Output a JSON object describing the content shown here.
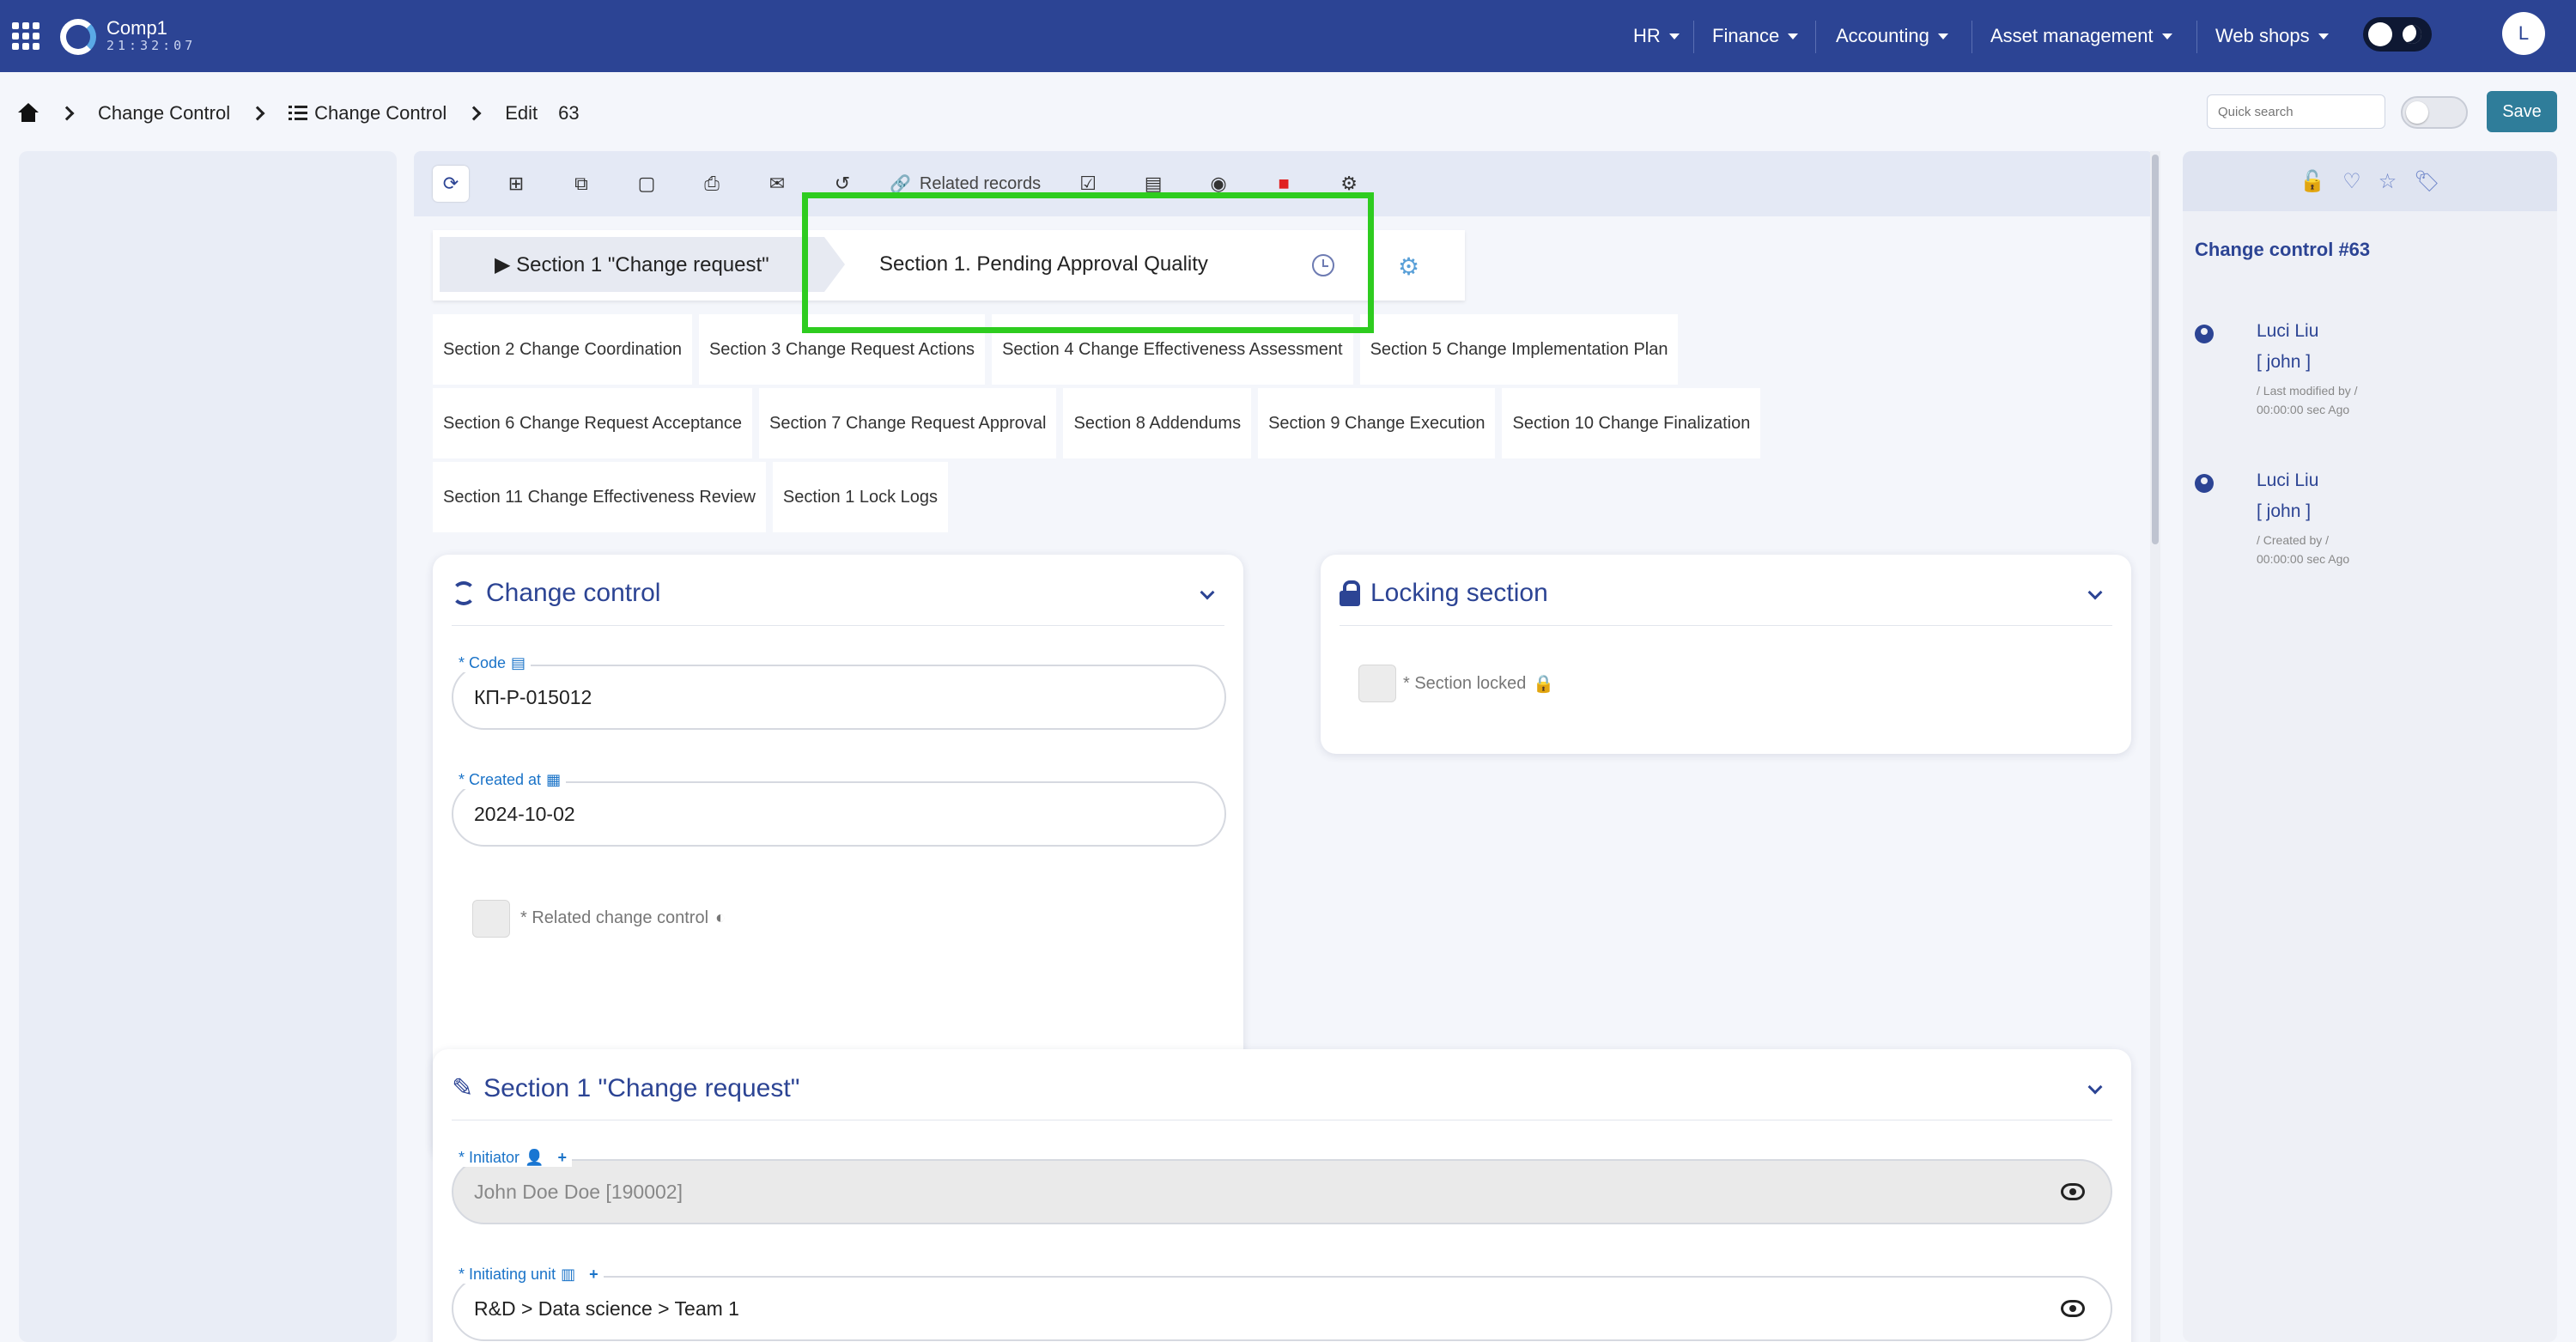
{
  "topbar": {
    "company": "Comp1",
    "time": "21:32:07",
    "menus": [
      "HR",
      "Finance",
      "Accounting",
      "Asset management",
      "Web shops"
    ],
    "avatar_letter": "L"
  },
  "breadcrumb": {
    "items": [
      "Change Control",
      "Change Control",
      "Edit",
      "63"
    ]
  },
  "quick_search": {
    "placeholder": "Quick search"
  },
  "save_label": "Save",
  "toolbar": {
    "related_records": "Related records"
  },
  "steps": {
    "step1": "▶ Section 1 \"Change request\"",
    "step2": "Section 1. Pending Approval Quality"
  },
  "tabs": [
    [
      "Section 2 Change Coordination",
      "Section 3 Change Request Actions",
      "Section 4 Change Effectiveness Assessment",
      "Section 5 Change Implementation Plan"
    ],
    [
      "Section 6 Change Request Acceptance",
      "Section 7 Change Request Approval",
      "Section 8 Addendums",
      "Section 9 Change Execution",
      "Section 10 Change Finalization"
    ],
    [
      "Section 11 Change Effectiveness Review",
      "Section 1 Lock Logs"
    ]
  ],
  "change_control_card": {
    "title": "Change control",
    "code_label": "* Code",
    "code_value": "КП-Р-015012",
    "created_label": "* Created at",
    "created_value": "2024-10-02",
    "related_label": "* Related change control"
  },
  "locking_card": {
    "title": "Locking section",
    "locked_label": "* Section locked"
  },
  "section1_card": {
    "title": "Section 1 \"Change request\"",
    "initiator_label": "* Initiator",
    "initiator_value": "John Doe Doe [190002]",
    "unit_label": "* Initiating unit",
    "unit_value": "R&D > Data science > Team 1"
  },
  "right_panel": {
    "title": "Change control #63",
    "entries": [
      {
        "name": "Luci Liu",
        "login": "[ john ]",
        "meta1": "/ Last modified by /",
        "meta2": "00:00:00 sec Ago"
      },
      {
        "name": "Luci Liu",
        "login": "[ john ]",
        "meta1": "/ Created by /",
        "meta2": "00:00:00 sec Ago"
      }
    ]
  },
  "colors": {
    "nav": "#2c4494",
    "accent": "#2c4494",
    "save": "#2f7d9a",
    "highlight": "#2ecc1f"
  }
}
